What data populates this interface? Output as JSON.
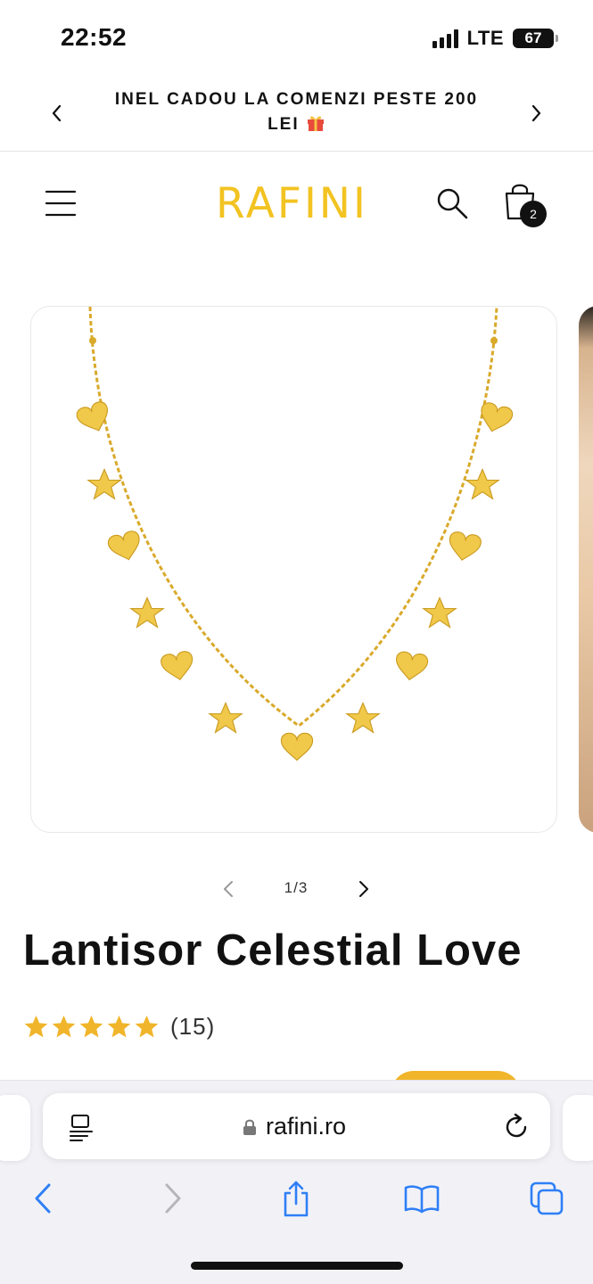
{
  "status": {
    "time": "22:52",
    "network": "LTE",
    "battery": "67"
  },
  "announcement": {
    "line1": "INEL CADOU LA COMENZI PESTE 200",
    "line2": "LEI"
  },
  "header": {
    "logo": "RAFINI",
    "cart_count": "2"
  },
  "gallery": {
    "counter": "1/3"
  },
  "product": {
    "title": "Lantisor Celestial Love",
    "rating": 5,
    "rating_max": 5,
    "review_count": "(15)"
  },
  "browser": {
    "url": "rafini.ro"
  },
  "colors": {
    "brand_gold": "#f2c321",
    "star_gold": "#f0b52b",
    "ios_blue": "#2f7ff7",
    "pendant_gold": "#f0c84a"
  },
  "icons": [
    "menu-icon",
    "search-icon",
    "shopping-bag-icon",
    "gift-icon",
    "chevron-left-icon",
    "chevron-right-icon",
    "lock-icon",
    "reload-icon",
    "reader-icon",
    "share-icon",
    "bookmarks-icon",
    "tabs-icon"
  ]
}
